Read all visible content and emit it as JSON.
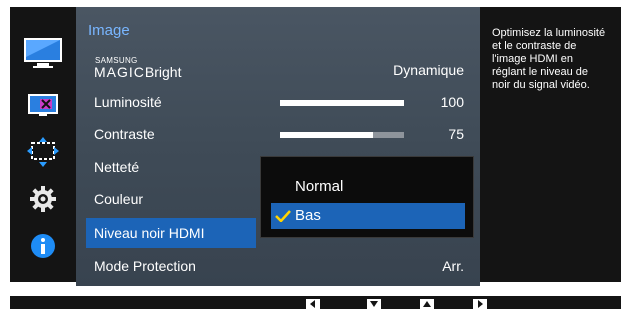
{
  "menu": {
    "title": "Image",
    "items": [
      {
        "id": "magic-bright",
        "logo_top": "SAMSUNG",
        "logo_main": "MAGIC",
        "label": "Bright",
        "value": "Dynamique"
      },
      {
        "id": "luminosite",
        "label": "Luminosité",
        "value": "100",
        "level": 1.0
      },
      {
        "id": "contraste",
        "label": "Contraste",
        "value": "75",
        "level": 0.75
      },
      {
        "id": "nettete",
        "label": "Netteté"
      },
      {
        "id": "couleur",
        "label": "Couleur"
      },
      {
        "id": "niveau-noir-hdmi",
        "label": "Niveau noir HDMI",
        "selected": true
      },
      {
        "id": "mode-protection",
        "label": "Mode Protection",
        "value": "Arr."
      }
    ]
  },
  "dropdown": {
    "options": [
      {
        "label": "Normal",
        "checked": false
      },
      {
        "label": "Bas",
        "checked": true
      }
    ]
  },
  "help_text": [
    "Optimisez la luminosité",
    "et le contraste de",
    "l'image HDMI en",
    "réglant le niveau de",
    "noir du signal vidéo."
  ],
  "side_icons": [
    "picture-icon",
    "color-icon",
    "size-position-icon",
    "system-gear-icon",
    "information-icon"
  ],
  "nav_keys": [
    "left-arrow-icon",
    "down-arrow-icon",
    "up-arrow-icon",
    "right-arrow-icon"
  ],
  "colors": {
    "highlight": "#1c64b7",
    "title": "#79b6ff",
    "panel": "#424e5a",
    "background": "#141414"
  }
}
